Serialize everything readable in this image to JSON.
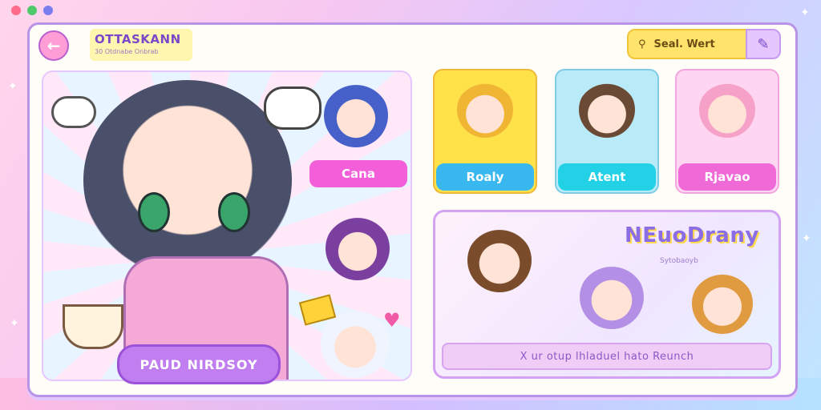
{
  "window": {
    "dots": [
      "#ff6b8a",
      "#4fc86b",
      "#7b7cf0"
    ],
    "logo_title": "OTTASKANN",
    "logo_sub": "30 Otdnabe Onbrab"
  },
  "toolbar": {
    "search_placeholder": "Seal. Wert"
  },
  "hero": {
    "button_label": "PAUD NIRDSOY",
    "side_button_label": "Cana"
  },
  "cards": [
    {
      "label": "Roaly",
      "bg": "#ffe24a",
      "btn": "#39b8f0"
    },
    {
      "label": "Atent",
      "bg": "#b9eaf7",
      "btn": "#22d1e6"
    },
    {
      "label": "Rjavao",
      "bg": "#ffd6f2",
      "btn": "#f06ad7"
    }
  ],
  "banner": {
    "title": "NEuoDrany",
    "subtitle": "Sytobaoyb",
    "bar_text": "X ur otup lhladuel hato Reunch"
  }
}
